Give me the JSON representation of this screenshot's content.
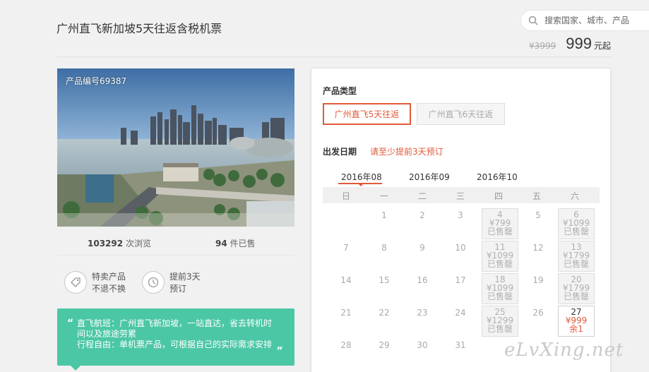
{
  "header": {
    "title": "广州直飞新加坡5天往返含税机票",
    "search_placeholder": "搜索国家、城市、产品",
    "original_price": "¥3999",
    "price": "999",
    "price_unit": "元起"
  },
  "product": {
    "code_label": "产品编号69387",
    "views_count": "103292",
    "views_label": "次浏览",
    "sold_count": "94",
    "sold_label": "件已售"
  },
  "features": [
    {
      "icon": "tag-icon",
      "line1": "特卖产品",
      "line2": "不退不换"
    },
    {
      "icon": "clock-icon",
      "line1": "提前3天",
      "line2": "预订"
    }
  ],
  "note": {
    "open_quote": "“",
    "close_quote": "„",
    "line1": "直飞航班：广州直飞新加坡，一站直达，省去转机时",
    "line2": "间以及旅途劳累",
    "line3": "行程自由：单机票产品，可根据自己的实际需求安排"
  },
  "booking": {
    "product_type_label": "产品类型",
    "types": [
      "广州直飞5天往返",
      "广州直飞6天往返"
    ],
    "depart_label": "出发日期",
    "advance_hint": "请至少提前3天预订",
    "months": [
      "2016年08",
      "2016年09",
      "2016年10"
    ],
    "weekdays": [
      "日",
      "一",
      "二",
      "三",
      "四",
      "五",
      "六"
    ]
  },
  "calendar": [
    {
      "row": 0,
      "col": 1,
      "day": "1"
    },
    {
      "row": 0,
      "col": 2,
      "day": "2"
    },
    {
      "row": 0,
      "col": 3,
      "day": "3"
    },
    {
      "row": 0,
      "col": 4,
      "day": "4",
      "price": "¥799",
      "status": "已售罄"
    },
    {
      "row": 0,
      "col": 5,
      "day": "5"
    },
    {
      "row": 0,
      "col": 6,
      "day": "6",
      "price": "¥1099",
      "status": "已售罄"
    },
    {
      "row": 1,
      "col": 0,
      "day": "7"
    },
    {
      "row": 1,
      "col": 1,
      "day": "8"
    },
    {
      "row": 1,
      "col": 2,
      "day": "9"
    },
    {
      "row": 1,
      "col": 3,
      "day": "10"
    },
    {
      "row": 1,
      "col": 4,
      "day": "11",
      "price": "¥1099",
      "status": "已售罄"
    },
    {
      "row": 1,
      "col": 5,
      "day": "12"
    },
    {
      "row": 1,
      "col": 6,
      "day": "13",
      "price": "¥1799",
      "status": "已售罄"
    },
    {
      "row": 2,
      "col": 0,
      "day": "14"
    },
    {
      "row": 2,
      "col": 1,
      "day": "15"
    },
    {
      "row": 2,
      "col": 2,
      "day": "16"
    },
    {
      "row": 2,
      "col": 3,
      "day": "17"
    },
    {
      "row": 2,
      "col": 4,
      "day": "18",
      "price": "¥1099",
      "status": "已售罄"
    },
    {
      "row": 2,
      "col": 5,
      "day": "19"
    },
    {
      "row": 2,
      "col": 6,
      "day": "20",
      "price": "¥1799",
      "status": "已售罄"
    },
    {
      "row": 3,
      "col": 0,
      "day": "21"
    },
    {
      "row": 3,
      "col": 1,
      "day": "22"
    },
    {
      "row": 3,
      "col": 2,
      "day": "23"
    },
    {
      "row": 3,
      "col": 3,
      "day": "24"
    },
    {
      "row": 3,
      "col": 4,
      "day": "25",
      "price": "¥1299",
      "status": "已售罄"
    },
    {
      "row": 3,
      "col": 5,
      "day": "26"
    },
    {
      "row": 3,
      "col": 6,
      "day": "27",
      "price": "¥999",
      "status": "余1",
      "available": true
    },
    {
      "row": 4,
      "col": 0,
      "day": "28"
    },
    {
      "row": 4,
      "col": 1,
      "day": "29"
    },
    {
      "row": 4,
      "col": 2,
      "day": "30"
    },
    {
      "row": 4,
      "col": 3,
      "day": "31"
    }
  ],
  "watermark": "eLvXing.net",
  "colors": {
    "accent": "#e05a3a",
    "note_bg": "#4cc7a5"
  }
}
